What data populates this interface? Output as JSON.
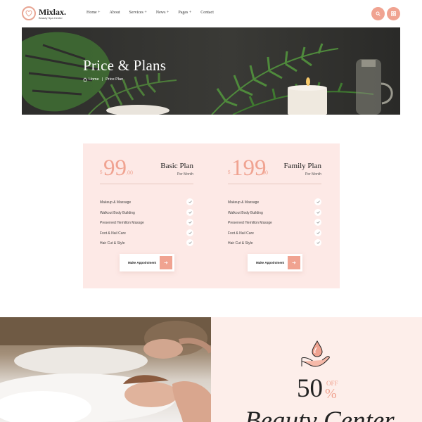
{
  "brand": {
    "name": "Mixlax.",
    "tagline": "Beauty Spa Center"
  },
  "nav": {
    "items": [
      {
        "label": "Home +"
      },
      {
        "label": "About"
      },
      {
        "label": "Services +"
      },
      {
        "label": "News +"
      },
      {
        "label": "Pages +"
      },
      {
        "label": "Contact"
      }
    ]
  },
  "header_buttons": {
    "search_icon": "search-icon",
    "menu_icon": "grid-menu-icon"
  },
  "hero": {
    "title": "Price & Plans",
    "breadcrumb": {
      "home": "Home",
      "separator": "|",
      "current": "Price Plan"
    }
  },
  "plans": [
    {
      "currency": "$",
      "amount": "99",
      "decimal": ".00",
      "name": "Basic Plan",
      "period": "Per Month",
      "features": [
        "Makeup & Massage",
        "Walkout Body Building",
        "Preserved Hemilton Massge",
        "Foot & Nail Care",
        "Hair Cut & Style"
      ],
      "button": "Make Appointment"
    },
    {
      "currency": "$",
      "amount": "199",
      "decimal": ".00",
      "name": "Family Plan",
      "period": "Per Month",
      "features": [
        "Makeup & Massage",
        "Walkout Body Building",
        "Preserved Hemilton Massge",
        "Foot & Nail Care",
        "Hair Cut & Style"
      ],
      "button": "Make Appointment"
    }
  ],
  "promo": {
    "number": "50",
    "off": "OFF",
    "percent": "%",
    "title": "Beauty Center"
  },
  "colors": {
    "accent": "#f0a391",
    "pricing_bg": "#fde9e6",
    "promo_bg": "#fdeeea",
    "text_dark": "#222222"
  }
}
